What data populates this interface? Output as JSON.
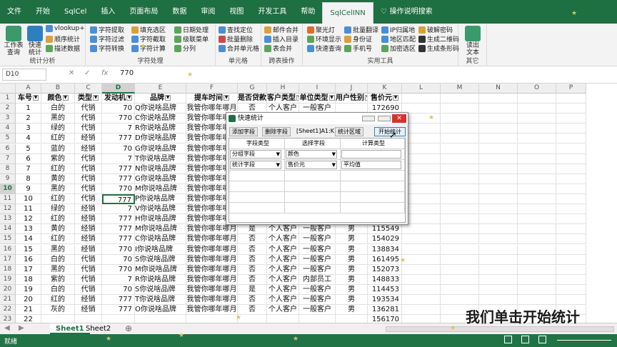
{
  "tabs": [
    "文件",
    "开始",
    "SqlCel",
    "插入",
    "页面布局",
    "数据",
    "审阅",
    "视图",
    "开发工具",
    "帮助",
    "SqlCelINN",
    "操作说明搜索"
  ],
  "ribbon": {
    "stat_group": {
      "label": "统计分析",
      "workbook_query": "工作表查询",
      "quick_stat": "快速统计",
      "vlookup": "vlookup+",
      "order_stat": "顺序统计",
      "describe": "描述数据"
    },
    "char_group": {
      "label": "字符处理",
      "extract": "字符提取",
      "filter": "字符过滤",
      "convert": "字符转换",
      "fill": "填充选区",
      "intercept": "字符截取",
      "calc": "字符计算",
      "date": "日期处理",
      "level": "级联菜单",
      "split": "分列"
    },
    "cell_group": {
      "label": "单元格",
      "find": "查找定位",
      "batch_delete": "批量删除",
      "merge": "合并单元格"
    },
    "table_group": {
      "label": "跨表操作",
      "mail_merge": "邮件合并",
      "insert_toc": "插入目录",
      "merge_tables": "表合并"
    },
    "tool_group": {
      "label": "实用工具",
      "spotlight": "聚光灯",
      "env": "环境显示",
      "fast_query": "快速查询",
      "translate": "批量翻译",
      "idcard": "身份证",
      "phone": "手机号",
      "ip": "IP归属地",
      "region": "地区匹配",
      "encrypt": "加密选区",
      "decrypt": "破解密码",
      "qrcode": "生成二维码",
      "barcode": "生成条形码"
    },
    "other_group": {
      "label": "其它",
      "read_text": "读出文本"
    }
  },
  "formula_bar": {
    "name_box": "D10",
    "fx": "fx",
    "value": "770"
  },
  "columns": [
    "A",
    "B",
    "C",
    "D",
    "E",
    "F",
    "G",
    "H",
    "I",
    "J",
    "K",
    "L",
    "M",
    "N",
    "O",
    "P"
  ],
  "headers": [
    "车号",
    "颜色",
    "类型",
    "发动机",
    "品牌",
    "提车时间",
    "是否贷款",
    "客户类型",
    "单位类型",
    "用户性别",
    "售价元"
  ],
  "rows": [
    [
      "1",
      "白的",
      "代销",
      "70",
      "Q你说啥品牌",
      "我管你哪年哪月",
      "否",
      "个人客户",
      "一般客户",
      "",
      "172690"
    ],
    [
      "2",
      "黑的",
      "代销",
      "770",
      "C你说啥品牌",
      "我管你哪年哪月",
      "否",
      "个人客户",
      "一般客户",
      "",
      "115799"
    ],
    [
      "3",
      "绿的",
      "代销",
      "7",
      "R你说啥品牌",
      "我管你哪年哪月",
      "否",
      "个人客户",
      "一般客户",
      "",
      "141828"
    ],
    [
      "4",
      "红的",
      "经销",
      "777",
      "D你说啥品牌",
      "我管你哪年哪月",
      "否",
      "个人客户",
      "一般客户",
      "",
      "149719"
    ],
    [
      "5",
      "蓝的",
      "经销",
      "70",
      "G你说啥品牌",
      "我管你哪年哪月",
      "否",
      "个人客户",
      "一般客户",
      "",
      "179695"
    ],
    [
      "6",
      "紫的",
      "代销",
      "7",
      "T你说啥品牌",
      "我管你哪年哪月",
      "否",
      "个人客户",
      "一般客户",
      "",
      "113122"
    ],
    [
      "7",
      "红的",
      "代销",
      "777",
      "N你说啥品牌",
      "我管你哪年哪月",
      "否",
      "个人客户",
      "一般客户",
      "",
      "145087"
    ],
    [
      "8",
      "黄的",
      "代销",
      "777",
      "G你说啥品牌",
      "我管你哪年哪月",
      "否",
      "个人客户",
      "一般客户",
      "",
      "173389"
    ],
    [
      "9",
      "黑的",
      "代销",
      "770",
      "M你说啥品牌",
      "我管你哪年哪月",
      "否",
      "个人客户",
      "一般客户",
      "",
      "179807"
    ],
    [
      "10",
      "红的",
      "代销",
      "777",
      "P你说啥品牌",
      "我管你哪年哪月",
      "否",
      "个人客户",
      "一般客户",
      "",
      "101210"
    ],
    [
      "11",
      "绿的",
      "经销",
      "7",
      "V你说啥品牌",
      "我管你哪年哪月",
      "否",
      "个人客户",
      "一般客户",
      "",
      "154884"
    ],
    [
      "12",
      "红的",
      "经销",
      "777",
      "H你说啥品牌",
      "我管你哪年哪月",
      "否",
      "个人客户",
      "一般客户",
      "",
      "120171"
    ],
    [
      "13",
      "黄的",
      "经销",
      "777",
      "M你说啥品牌",
      "我管你哪年哪月",
      "是",
      "个人客户",
      "一般客户",
      "男",
      "115549"
    ],
    [
      "14",
      "红的",
      "经销",
      "777",
      "C你说啥品牌",
      "我管你哪年哪月",
      "否",
      "个人客户",
      "一般客户",
      "男",
      "154029"
    ],
    [
      "15",
      "黑的",
      "经销",
      "770",
      "I你说啥品牌",
      "我管你哪年哪月",
      "否",
      "个人客户",
      "一般客户",
      "男",
      "138834"
    ],
    [
      "16",
      "白的",
      "代销",
      "70",
      "S你说啥品牌",
      "我管你哪年哪月",
      "否",
      "个人客户",
      "一般客户",
      "男",
      "161495"
    ],
    [
      "17",
      "黑的",
      "代销",
      "770",
      "M你说啥品牌",
      "我管你哪年哪月",
      "否",
      "个人客户",
      "一般客户",
      "男",
      "152073"
    ],
    [
      "18",
      "紫的",
      "代销",
      "7",
      "R你说啥品牌",
      "我管你哪年哪月",
      "否",
      "个人客户",
      "内部员工",
      "男",
      "148833"
    ],
    [
      "19",
      "白的",
      "代销",
      "70",
      "S你说啥品牌",
      "我管你哪年哪月",
      "是",
      "个人客户",
      "一般客户",
      "男",
      "114453"
    ],
    [
      "20",
      "红的",
      "经销",
      "777",
      "T你说啥品牌",
      "我管你哪年哪月",
      "否",
      "个人客户",
      "一般客户",
      "男",
      "193534"
    ],
    [
      "21",
      "灰的",
      "经销",
      "777",
      "O你说啥品牌",
      "我管你哪年哪月",
      "否",
      "个人客户",
      "一般客户",
      "男",
      "136281"
    ],
    [
      "22",
      "",
      "",
      "",
      "",
      "",
      "",
      "",
      "",
      "",
      "156170"
    ]
  ],
  "sheet_tabs": [
    "Sheet1",
    "Sheet2"
  ],
  "status": {
    "ready": "就绪"
  },
  "dialog": {
    "title": "快速统计",
    "add_field": "添加字段",
    "delete_field": "删除字段",
    "range": "[Sheet1]A1:K",
    "stat_region": "统计区域",
    "start": "开始统计",
    "col_field_type": "字段类型",
    "col_select_field": "选择字段",
    "col_calc_type": "计算类型",
    "row1": {
      "type": "分组字段",
      "field": "颜色",
      "calc": ""
    },
    "row2": {
      "type": "统计字段",
      "field": "售价元",
      "calc": "平均值"
    }
  },
  "subtitle": "我们单击开始统计",
  "colors": {
    "excel_green": "#217346",
    "ribbon_bg": "#f3f3f3"
  }
}
